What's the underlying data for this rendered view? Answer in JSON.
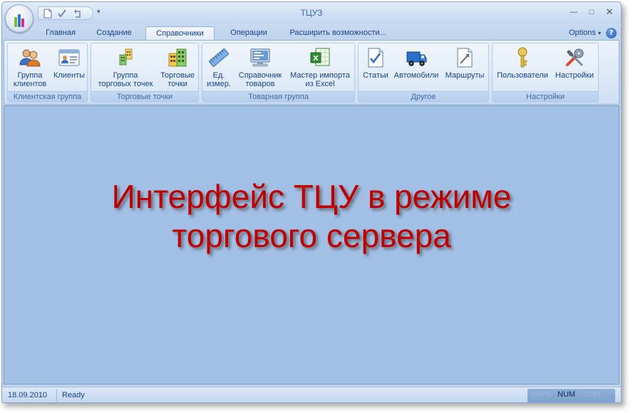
{
  "window": {
    "title": "ТЦУЗ"
  },
  "tabs": [
    {
      "label": "Главная",
      "active": false
    },
    {
      "label": "Создание",
      "active": false
    },
    {
      "label": "Справочники",
      "active": true
    },
    {
      "label": "Операции",
      "active": false
    },
    {
      "label": "Расширить возможности...",
      "active": false
    }
  ],
  "options_label": "Options",
  "help_label": "?",
  "ribbon": {
    "groups": [
      {
        "label": "Клиентская группа",
        "buttons": [
          {
            "label": "Группа клиентов",
            "line1": "Группа",
            "line2": "клиентов",
            "icon": "users-icon"
          },
          {
            "label": "Клиенты",
            "line1": "Клиенты",
            "line2": "",
            "icon": "contact-card-icon"
          }
        ]
      },
      {
        "label": "Торговые точки",
        "buttons": [
          {
            "label": "Группа торговых точек",
            "line1": "Группа",
            "line2": "торговых точек",
            "icon": "building-group-icon"
          },
          {
            "label": "Торговые точки",
            "line1": "Торговые",
            "line2": "точки",
            "icon": "building-icon"
          }
        ]
      },
      {
        "label": "Товарная группа",
        "buttons": [
          {
            "label": "Ед. измер.",
            "line1": "Ед.",
            "line2": "измер.",
            "icon": "ruler-icon"
          },
          {
            "label": "Справочник товаров",
            "line1": "Справочник",
            "line2": "товаров",
            "icon": "monitor-catalog-icon"
          },
          {
            "label": "Мастер импорта из Excel",
            "line1": "Мастер импорта",
            "line2": "из Excel",
            "icon": "excel-import-icon"
          }
        ]
      },
      {
        "label": "Другое",
        "buttons": [
          {
            "label": "Статьи",
            "line1": "Статьи",
            "line2": "",
            "icon": "checklist-icon"
          },
          {
            "label": "Автомобили",
            "line1": "Автомобили",
            "line2": "",
            "icon": "truck-icon"
          },
          {
            "label": "Маршруты",
            "line1": "Маршруты",
            "line2": "",
            "icon": "route-document-icon"
          }
        ]
      },
      {
        "label": "Настройки",
        "buttons": [
          {
            "label": "Пользователи",
            "line1": "Пользователи",
            "line2": "",
            "icon": "key-icon"
          },
          {
            "label": "Настройки",
            "line1": "Настройки",
            "line2": "",
            "icon": "tools-icon"
          }
        ]
      }
    ]
  },
  "content": {
    "headline_line1": "Интерфейс ТЦУ в режиме",
    "headline_line2": "торгового сервера"
  },
  "status": {
    "date": "18.09.2010",
    "state": "Ready",
    "caps": "CAPS",
    "num": "NUM",
    "scrl": "SCRL"
  },
  "colors": {
    "accent": "#15428b",
    "content_bg": "#a2c0e5",
    "headline": "#c00000"
  }
}
